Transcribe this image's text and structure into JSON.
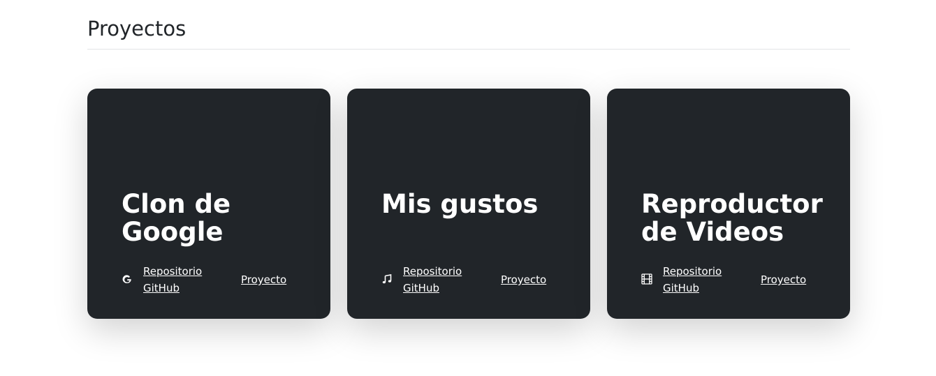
{
  "section": {
    "title": "Proyectos"
  },
  "cards": [
    {
      "title": "Clon de Google",
      "icon": "google-icon",
      "repo_label": "Repositorio GitHub",
      "project_label": "Proyecto"
    },
    {
      "title": "Mis gustos",
      "icon": "music-note-icon",
      "repo_label": "Repositorio GitHub",
      "project_label": "Proyecto"
    },
    {
      "title": "Reproductor de Videos",
      "icon": "film-icon",
      "repo_label": "Repositorio GitHub",
      "project_label": "Proyecto"
    }
  ],
  "colors": {
    "card_background": "#212529",
    "text_dark": "#212529",
    "text_light": "#ffffff"
  }
}
